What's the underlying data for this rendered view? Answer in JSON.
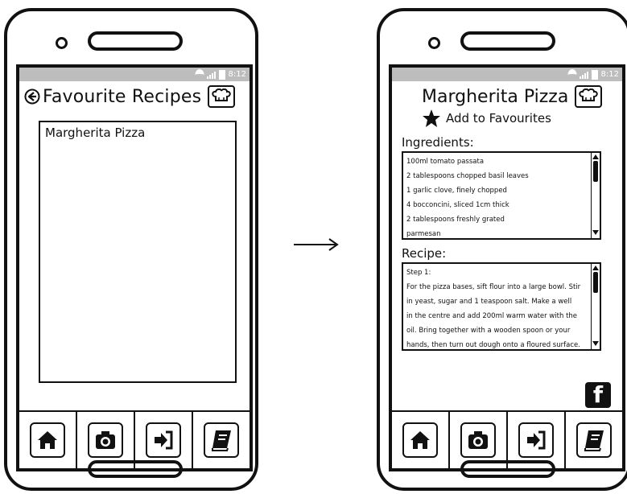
{
  "status": {
    "time": "8:12"
  },
  "left_screen": {
    "title": "Favourite Recipes",
    "list_items": [
      "Margherita Pizza"
    ]
  },
  "right_screen": {
    "title": "Margherita Pizza",
    "favourite_label": "Add to Favourites",
    "ingredients_label": "Ingredients:",
    "ingredients": [
      "100ml tomato passata",
      "2 tablespoons chopped basil leaves",
      "1 garlic clove, finely chopped",
      "4 bocconcini, sliced 1cm thick",
      "2 tablespoons freshly grated",
      "parmesan"
    ],
    "recipe_label": "Recipe:",
    "recipe_lines": [
      "Step 1:",
      "For the pizza bases, sift flour into a large bowl. Stir",
      "in yeast, sugar and 1 teaspoon salt. Make a well",
      "in the centre and add 200ml warm water with the",
      "oil. Bring together with a wooden spoon or your",
      "hands, then turn out dough onto a floured surface."
    ],
    "facebook_glyph": "f"
  },
  "icons": {
    "back": "back-arrow-icon",
    "chef": "chef-hat-icon",
    "star": "star-icon",
    "home": "home-icon",
    "camera": "camera-icon",
    "login": "login-icon",
    "book": "book-icon",
    "facebook": "facebook-icon"
  }
}
